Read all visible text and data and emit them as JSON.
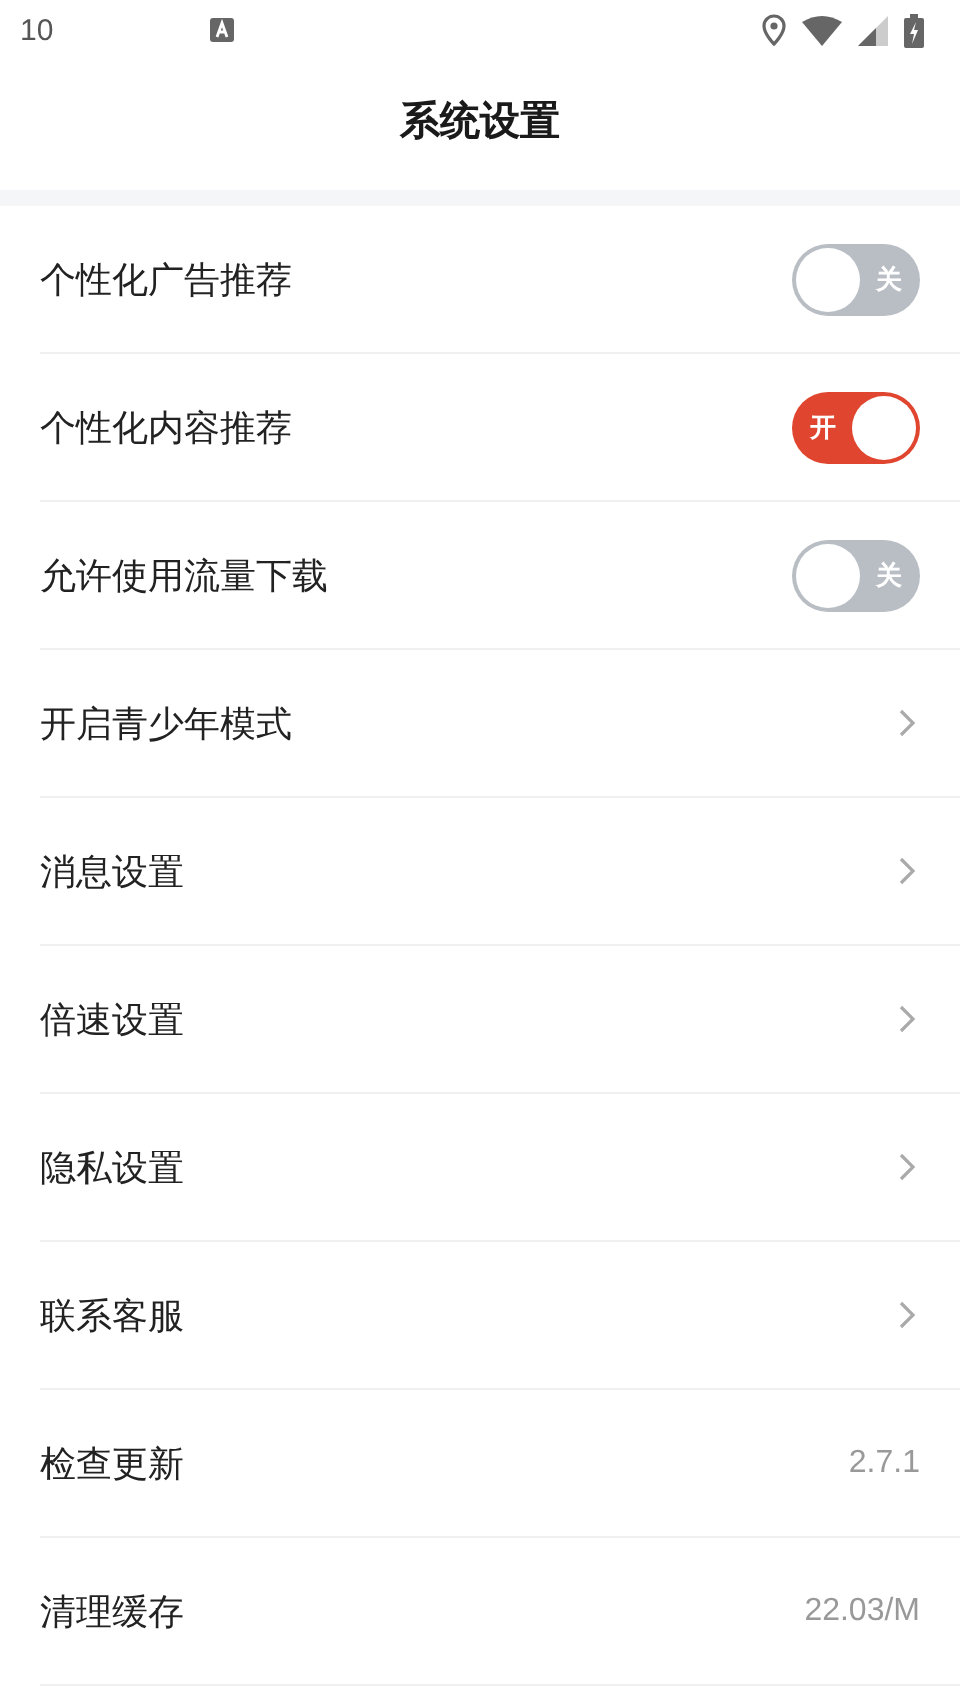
{
  "status_bar": {
    "time": "10"
  },
  "title": "系统设置",
  "settings": [
    {
      "kind": "toggle",
      "label": "个性化广告推荐",
      "on": false,
      "text": "关"
    },
    {
      "kind": "toggle",
      "label": "个性化内容推荐",
      "on": true,
      "text": "开"
    },
    {
      "kind": "toggle",
      "label": "允许使用流量下载",
      "on": false,
      "text": "关"
    },
    {
      "kind": "link",
      "label": "开启青少年模式"
    },
    {
      "kind": "link",
      "label": "消息设置"
    },
    {
      "kind": "link",
      "label": "倍速设置"
    },
    {
      "kind": "link",
      "label": "隐私设置"
    },
    {
      "kind": "link",
      "label": "联系客服"
    },
    {
      "kind": "value",
      "label": "检查更新",
      "value": "2.7.1"
    },
    {
      "kind": "value",
      "label": "清理缓存",
      "value": "22.03/M"
    }
  ]
}
